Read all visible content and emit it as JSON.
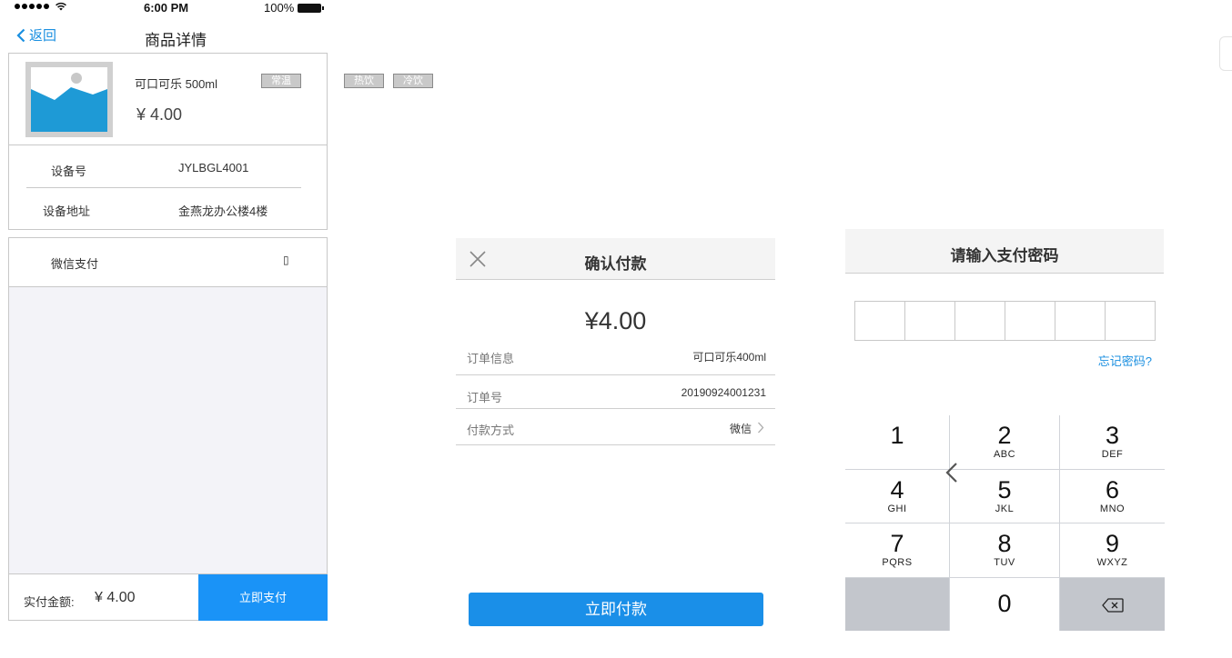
{
  "status_bar": {
    "time": "6:00 PM",
    "battery": "100%"
  },
  "product_page": {
    "back_label": "返回",
    "title": "商品详情",
    "product_name": "可口可乐  500ml",
    "price": "¥ 4.00",
    "temp_tag": "常温",
    "device_no_label": "设备号",
    "device_no_value": "JYLBGL4001",
    "device_addr_label": "设备地址",
    "device_addr_value": "金燕龙办公楼4楼",
    "payment_method": "微信支付",
    "payment_radio_glyph": "▯",
    "total_label": "实付金额:",
    "total_value": "¥ 4.00",
    "pay_button": "立即支付"
  },
  "floating_tags": {
    "hot": "热饮",
    "cold": "冷饮"
  },
  "confirm_panel": {
    "title": "确认付款",
    "amount": "¥4.00",
    "rows": [
      {
        "label": "订单信息",
        "value": "可口可乐400ml"
      },
      {
        "label": "订单号",
        "value": "20190924001231"
      },
      {
        "label": "付款方式",
        "value": "微信"
      }
    ],
    "confirm_button": "立即付款"
  },
  "password_panel": {
    "title": "请输入支付密码",
    "forgot": "忘记密码?",
    "keys": [
      {
        "num": "1",
        "sub": ""
      },
      {
        "num": "2",
        "sub": "ABC"
      },
      {
        "num": "3",
        "sub": "DEF"
      },
      {
        "num": "4",
        "sub": "GHI"
      },
      {
        "num": "5",
        "sub": "JKL"
      },
      {
        "num": "6",
        "sub": "MNO"
      },
      {
        "num": "7",
        "sub": "PQRS"
      },
      {
        "num": "8",
        "sub": "TUV"
      },
      {
        "num": "9",
        "sub": "WXYZ"
      },
      {
        "num": "0",
        "sub": ""
      }
    ]
  },
  "colors": {
    "accent": "#1a93f7",
    "link": "#1a8fe0",
    "image_blue": "#1e9ad6",
    "tag_gray": "#c9c9c9"
  }
}
